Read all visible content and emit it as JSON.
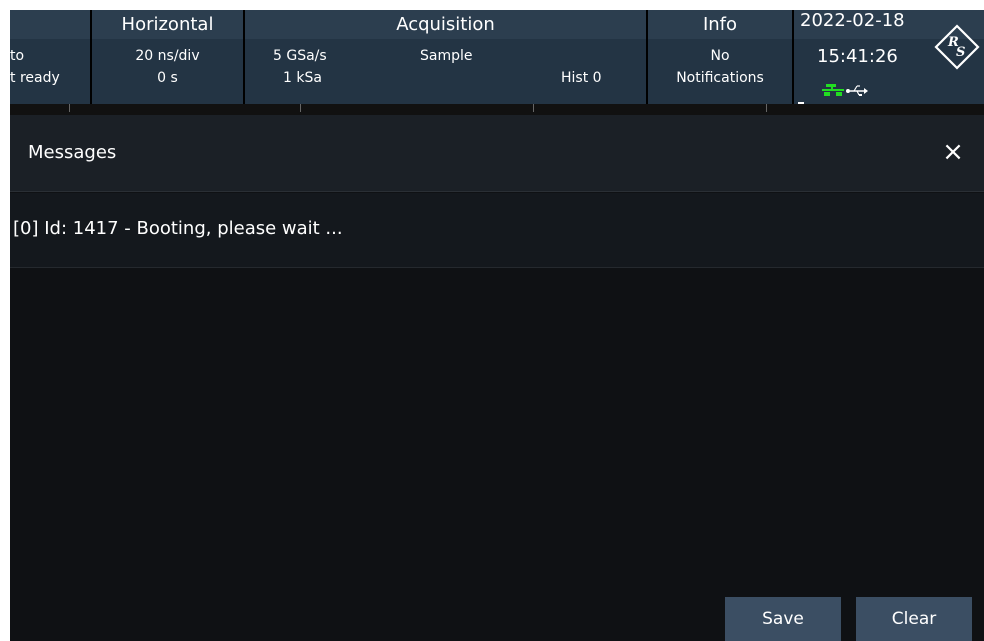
{
  "status_bar": {
    "trigger": {
      "mode_partial": "to",
      "state_partial": "t ready"
    },
    "horizontal": {
      "header": "Horizontal",
      "timebase": "20 ns/div",
      "position": "0 s"
    },
    "acquisition": {
      "header": "Acquisition",
      "sample_rate": "5 GSa/s",
      "mode": "Sample",
      "record_length": "1 kSa",
      "history": "Hist 0"
    },
    "info": {
      "header": "Info",
      "line1": "No",
      "line2": "Notifications"
    },
    "clock": {
      "date": "2022-02-18",
      "time": "15:41:26"
    },
    "icons": {
      "logo": "rohde-schwarz-logo",
      "network": "network-icon",
      "usb": "usb-icon"
    }
  },
  "dialog": {
    "title": "Messages",
    "close_icon": "×",
    "messages": [
      "[0] Id: 1417 - Booting, please wait ..."
    ],
    "save_label": "Save",
    "clear_label": "Clear"
  },
  "colors": {
    "header_bg": "#2c3e4f",
    "bar_bg": "#233444",
    "dialog_bg": "#0f1114",
    "button_bg": "#3b4e63",
    "network_green": "#22dd22"
  }
}
